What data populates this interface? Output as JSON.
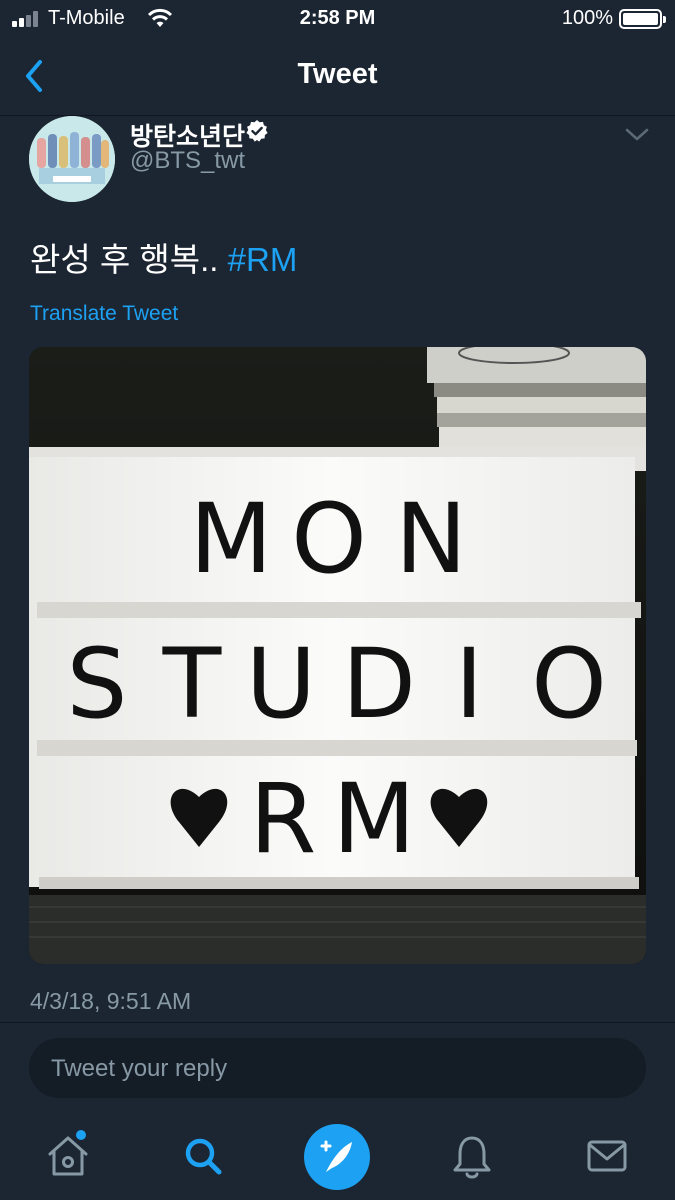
{
  "status_bar": {
    "carrier": "T-Mobile",
    "time": "2:58 PM",
    "battery": "100%",
    "icons": [
      "signal-icon",
      "wifi-icon",
      "battery-icon"
    ]
  },
  "nav": {
    "title": "Tweet",
    "back_icon": "chevron-left-icon"
  },
  "tweet": {
    "author": {
      "display_name": "방탄소년단",
      "handle": "@BTS_twt",
      "verified": true
    },
    "text": "완성 후 행복..",
    "hashtag": "#RM",
    "translate_label": "Translate Tweet",
    "image": {
      "lightbox_rows": [
        "MON",
        "STUDIO",
        "♥RM♥"
      ]
    },
    "timestamp": "4/3/18, 9:51 AM"
  },
  "reply": {
    "placeholder": "Tweet your reply"
  },
  "tab_bar": {
    "items": [
      "home-icon",
      "search-icon",
      "compose-icon",
      "notifications-icon",
      "messages-icon"
    ],
    "accent": "#1da1f2"
  },
  "colors": {
    "background": "#1c2532",
    "accent": "#1da1f2",
    "secondary_text": "#8899a6"
  }
}
